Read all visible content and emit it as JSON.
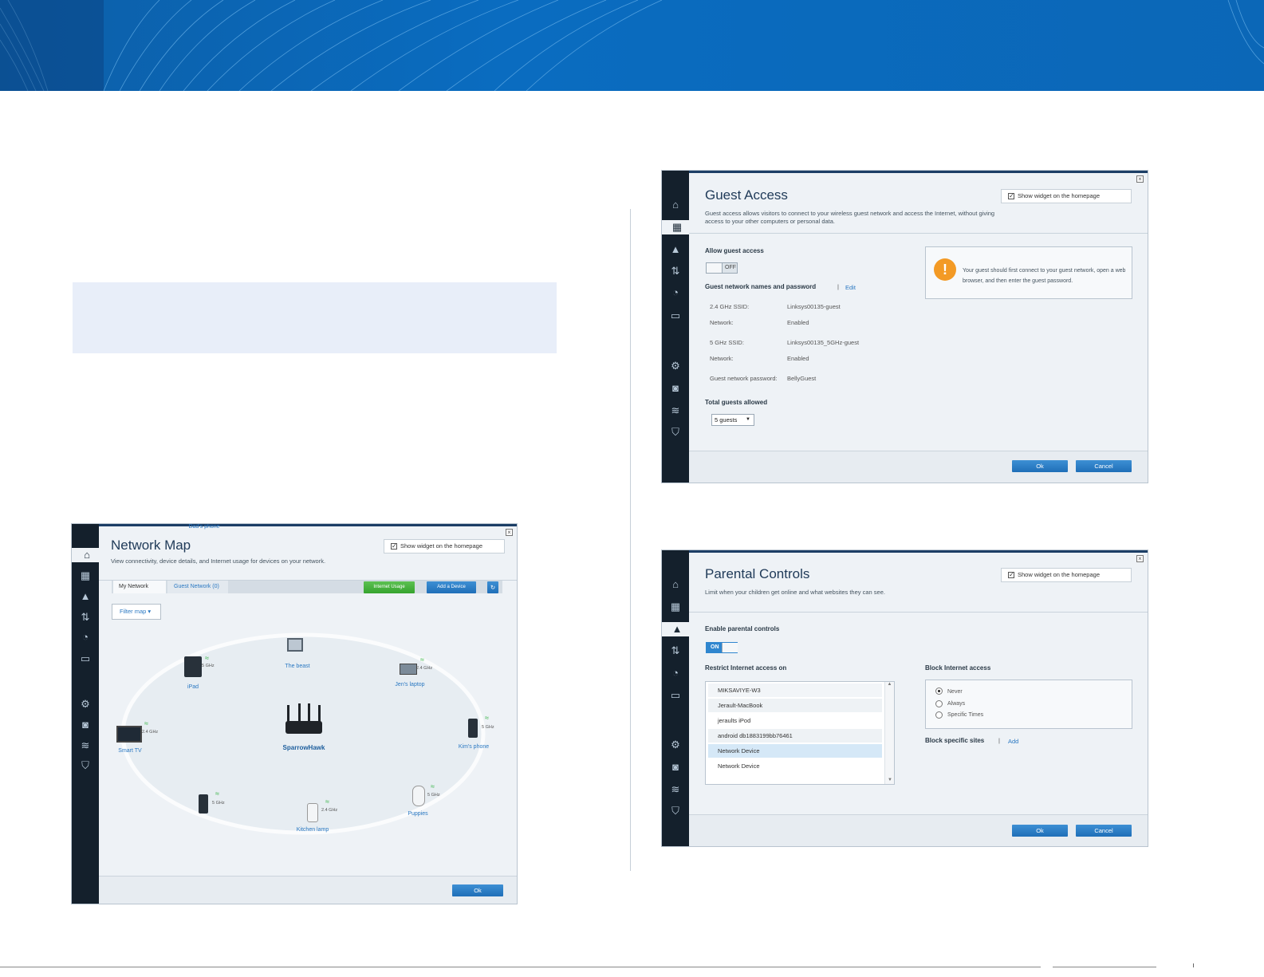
{
  "network_map": {
    "title": "Network Map",
    "description": "View connectivity, device details, and Internet usage for devices on your network.",
    "widget_label": "Show widget on the homepage",
    "tabs": [
      "My Network",
      "Guest Network (0)"
    ],
    "internet_usage_label": "Internet Usage",
    "add_device_label": "Add a Device",
    "filter_label": "Filter map",
    "router_name": "SparrowHawk",
    "devices": [
      {
        "name": "iPad",
        "band": "5 GHz"
      },
      {
        "name": "The beast",
        "band": ""
      },
      {
        "name": "Jen's laptop",
        "band": "2.4 GHz"
      },
      {
        "name": "Smart TV",
        "band": "2.4 GHz"
      },
      {
        "name": "Kim's phone",
        "band": "5 GHz"
      },
      {
        "name": "Dad's phone",
        "band": "5 GHz"
      },
      {
        "name": "Kitchen lamp",
        "band": "2.4 GHz"
      },
      {
        "name": "Puppies",
        "band": "5 GHz"
      }
    ],
    "ok_label": "Ok"
  },
  "guest_access": {
    "title": "Guest Access",
    "description": "Guest access allows visitors to connect to your wireless guest network and access the Internet, without giving access to your other computers or personal data.",
    "widget_label": "Show widget on the homepage",
    "allow_label": "Allow guest access",
    "toggle_state": "OFF",
    "names_label": "Guest network names and password",
    "edit_label": "Edit",
    "rows": [
      {
        "key": "2.4 GHz SSID:",
        "value": "Linksys00135-guest"
      },
      {
        "key": "Network:",
        "value": "Enabled"
      },
      {
        "key": "5 GHz SSID:",
        "value": "Linksys00135_5GHz-guest"
      },
      {
        "key": "Network:",
        "value": "Enabled"
      },
      {
        "key": "Guest network password:",
        "value": "BellyGuest"
      }
    ],
    "total_label": "Total guests allowed",
    "guests_value": "5 guests",
    "notice": "Your guest should first connect to your guest network, open a web browser, and then enter the guest password.",
    "ok_label": "Ok",
    "cancel_label": "Cancel"
  },
  "parental_controls": {
    "title": "Parental Controls",
    "description": "Limit when your children get online and what websites they can see.",
    "widget_label": "Show widget on the homepage",
    "enable_label": "Enable parental controls",
    "toggle_state": "ON",
    "restrict_label": "Restrict Internet access on",
    "device_list": [
      "MIKSAVIYE-W3",
      "Jerault-MacBook",
      "jeraults iPod",
      "android db1883199bb76461",
      "Network Device",
      "Network Device"
    ],
    "block_label": "Block Internet access",
    "block_options": [
      "Never",
      "Always",
      "Specific Times"
    ],
    "block_sites_label": "Block specific sites",
    "add_label": "Add",
    "ok_label": "Ok",
    "cancel_label": "Cancel"
  }
}
